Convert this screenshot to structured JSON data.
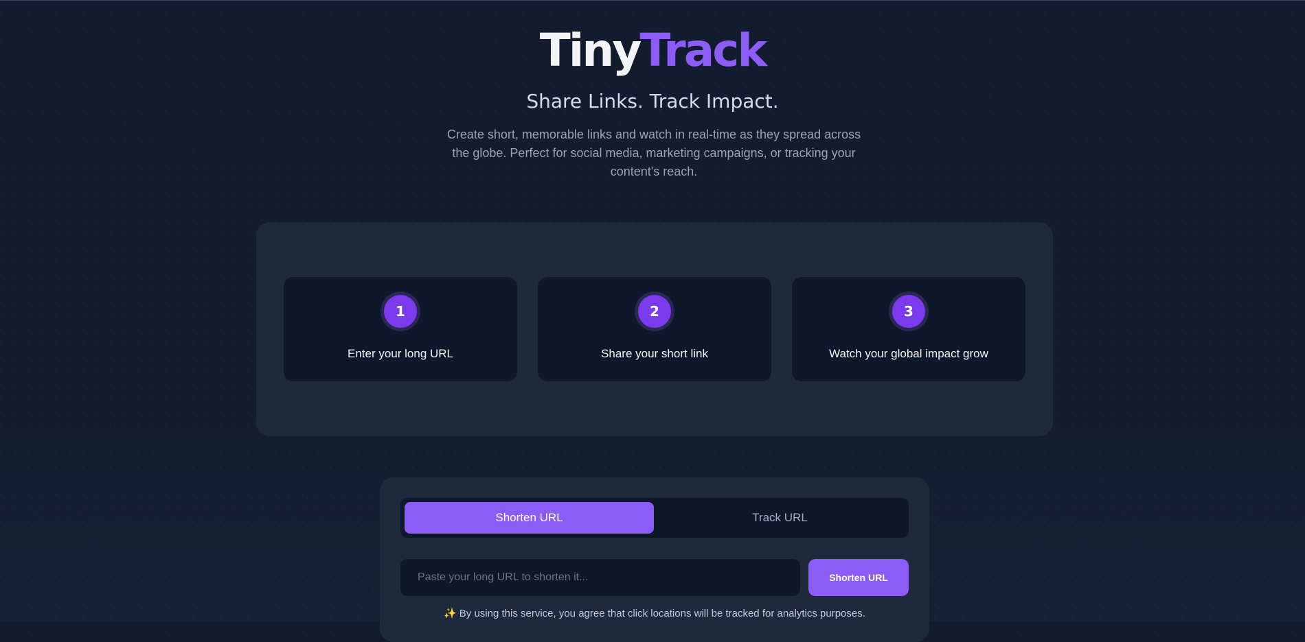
{
  "brand": {
    "name_part1": "Tiny",
    "name_part2": "Track",
    "accent_color": "#8b5cf6"
  },
  "hero": {
    "tagline": "Share Links. Track Impact.",
    "description": "Create short, memorable links and watch in real-time as they spread across the globe. Perfect for social media, marketing campaigns, or tracking your content's reach."
  },
  "steps": [
    {
      "number": "1",
      "label": "Enter your long URL"
    },
    {
      "number": "2",
      "label": "Share your short link"
    },
    {
      "number": "3",
      "label": "Watch your global impact grow"
    }
  ],
  "form": {
    "tabs": [
      {
        "label": "Shorten URL",
        "active": true
      },
      {
        "label": "Track URL",
        "active": false
      }
    ],
    "input_placeholder": "Paste your long URL to shorten it...",
    "input_value": "",
    "submit_label": "Shorten URL",
    "disclaimer_icon": "sparkles-icon",
    "disclaimer_glyph": "✨",
    "disclaimer": "By using this service, you agree that click locations will be tracked for analytics purposes."
  },
  "colors": {
    "background": "#131b2e",
    "panel": "#1e293b",
    "card": "#0f172a",
    "accent": "#8b5cf6"
  }
}
